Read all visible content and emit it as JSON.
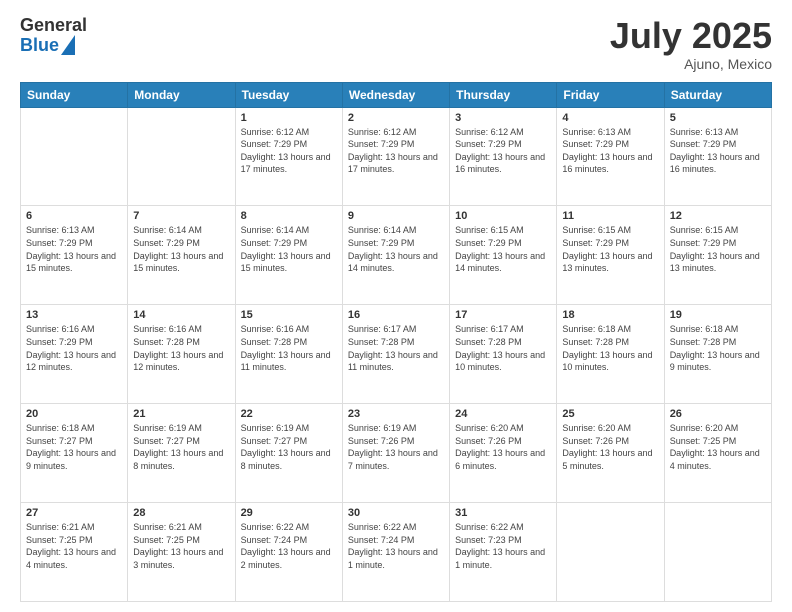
{
  "header": {
    "logo_general": "General",
    "logo_blue": "Blue",
    "month_title": "July 2025",
    "subtitle": "Ajuno, Mexico"
  },
  "weekdays": [
    "Sunday",
    "Monday",
    "Tuesday",
    "Wednesday",
    "Thursday",
    "Friday",
    "Saturday"
  ],
  "weeks": [
    [
      {
        "day": "",
        "info": ""
      },
      {
        "day": "",
        "info": ""
      },
      {
        "day": "1",
        "info": "Sunrise: 6:12 AM\nSunset: 7:29 PM\nDaylight: 13 hours and 17 minutes."
      },
      {
        "day": "2",
        "info": "Sunrise: 6:12 AM\nSunset: 7:29 PM\nDaylight: 13 hours and 17 minutes."
      },
      {
        "day": "3",
        "info": "Sunrise: 6:12 AM\nSunset: 7:29 PM\nDaylight: 13 hours and 16 minutes."
      },
      {
        "day": "4",
        "info": "Sunrise: 6:13 AM\nSunset: 7:29 PM\nDaylight: 13 hours and 16 minutes."
      },
      {
        "day": "5",
        "info": "Sunrise: 6:13 AM\nSunset: 7:29 PM\nDaylight: 13 hours and 16 minutes."
      }
    ],
    [
      {
        "day": "6",
        "info": "Sunrise: 6:13 AM\nSunset: 7:29 PM\nDaylight: 13 hours and 15 minutes."
      },
      {
        "day": "7",
        "info": "Sunrise: 6:14 AM\nSunset: 7:29 PM\nDaylight: 13 hours and 15 minutes."
      },
      {
        "day": "8",
        "info": "Sunrise: 6:14 AM\nSunset: 7:29 PM\nDaylight: 13 hours and 15 minutes."
      },
      {
        "day": "9",
        "info": "Sunrise: 6:14 AM\nSunset: 7:29 PM\nDaylight: 13 hours and 14 minutes."
      },
      {
        "day": "10",
        "info": "Sunrise: 6:15 AM\nSunset: 7:29 PM\nDaylight: 13 hours and 14 minutes."
      },
      {
        "day": "11",
        "info": "Sunrise: 6:15 AM\nSunset: 7:29 PM\nDaylight: 13 hours and 13 minutes."
      },
      {
        "day": "12",
        "info": "Sunrise: 6:15 AM\nSunset: 7:29 PM\nDaylight: 13 hours and 13 minutes."
      }
    ],
    [
      {
        "day": "13",
        "info": "Sunrise: 6:16 AM\nSunset: 7:29 PM\nDaylight: 13 hours and 12 minutes."
      },
      {
        "day": "14",
        "info": "Sunrise: 6:16 AM\nSunset: 7:28 PM\nDaylight: 13 hours and 12 minutes."
      },
      {
        "day": "15",
        "info": "Sunrise: 6:16 AM\nSunset: 7:28 PM\nDaylight: 13 hours and 11 minutes."
      },
      {
        "day": "16",
        "info": "Sunrise: 6:17 AM\nSunset: 7:28 PM\nDaylight: 13 hours and 11 minutes."
      },
      {
        "day": "17",
        "info": "Sunrise: 6:17 AM\nSunset: 7:28 PM\nDaylight: 13 hours and 10 minutes."
      },
      {
        "day": "18",
        "info": "Sunrise: 6:18 AM\nSunset: 7:28 PM\nDaylight: 13 hours and 10 minutes."
      },
      {
        "day": "19",
        "info": "Sunrise: 6:18 AM\nSunset: 7:28 PM\nDaylight: 13 hours and 9 minutes."
      }
    ],
    [
      {
        "day": "20",
        "info": "Sunrise: 6:18 AM\nSunset: 7:27 PM\nDaylight: 13 hours and 9 minutes."
      },
      {
        "day": "21",
        "info": "Sunrise: 6:19 AM\nSunset: 7:27 PM\nDaylight: 13 hours and 8 minutes."
      },
      {
        "day": "22",
        "info": "Sunrise: 6:19 AM\nSunset: 7:27 PM\nDaylight: 13 hours and 8 minutes."
      },
      {
        "day": "23",
        "info": "Sunrise: 6:19 AM\nSunset: 7:26 PM\nDaylight: 13 hours and 7 minutes."
      },
      {
        "day": "24",
        "info": "Sunrise: 6:20 AM\nSunset: 7:26 PM\nDaylight: 13 hours and 6 minutes."
      },
      {
        "day": "25",
        "info": "Sunrise: 6:20 AM\nSunset: 7:26 PM\nDaylight: 13 hours and 5 minutes."
      },
      {
        "day": "26",
        "info": "Sunrise: 6:20 AM\nSunset: 7:25 PM\nDaylight: 13 hours and 4 minutes."
      }
    ],
    [
      {
        "day": "27",
        "info": "Sunrise: 6:21 AM\nSunset: 7:25 PM\nDaylight: 13 hours and 4 minutes."
      },
      {
        "day": "28",
        "info": "Sunrise: 6:21 AM\nSunset: 7:25 PM\nDaylight: 13 hours and 3 minutes."
      },
      {
        "day": "29",
        "info": "Sunrise: 6:22 AM\nSunset: 7:24 PM\nDaylight: 13 hours and 2 minutes."
      },
      {
        "day": "30",
        "info": "Sunrise: 6:22 AM\nSunset: 7:24 PM\nDaylight: 13 hours and 1 minute."
      },
      {
        "day": "31",
        "info": "Sunrise: 6:22 AM\nSunset: 7:23 PM\nDaylight: 13 hours and 1 minute."
      },
      {
        "day": "",
        "info": ""
      },
      {
        "day": "",
        "info": ""
      }
    ]
  ]
}
